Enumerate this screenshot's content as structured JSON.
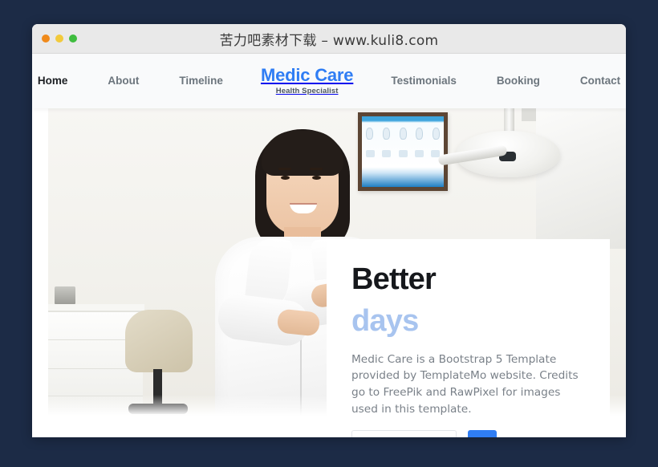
{
  "window": {
    "title": "苦力吧素材下载 – www.kuli8.com",
    "traffic_lights": [
      {
        "name": "close",
        "color": "#f08a1b"
      },
      {
        "name": "minimize",
        "color": "#f2ca3c"
      },
      {
        "name": "maximize",
        "color": "#3fbd3f"
      }
    ],
    "background_color": "#1c2b46"
  },
  "navbar": {
    "left_links": [
      {
        "label": "Home",
        "active": true
      },
      {
        "label": "About",
        "active": false
      },
      {
        "label": "Timeline",
        "active": false
      }
    ],
    "brand": {
      "name": "Medic Care",
      "subtitle": "Health Specialist",
      "color": "#2f7df4"
    },
    "right_links": [
      {
        "label": "Testimonials",
        "active": false
      },
      {
        "label": "Booking",
        "active": false
      },
      {
        "label": "Contact",
        "active": false
      }
    ]
  },
  "hero": {
    "image_alt": "Smiling female dentist in white lab coat with arms crossed standing in a dental clinic",
    "title_line_1": "Better",
    "title_line_2": "days",
    "title_line_2_color": "#a8c4ef",
    "description": "Medic Care is a Bootstrap 5 Template provided by TemplateMo website. Credits go to FreePik and RawPixel for images used in this template.",
    "form": {
      "input_placeholder": "",
      "input_value": "",
      "submit_label": ""
    }
  }
}
